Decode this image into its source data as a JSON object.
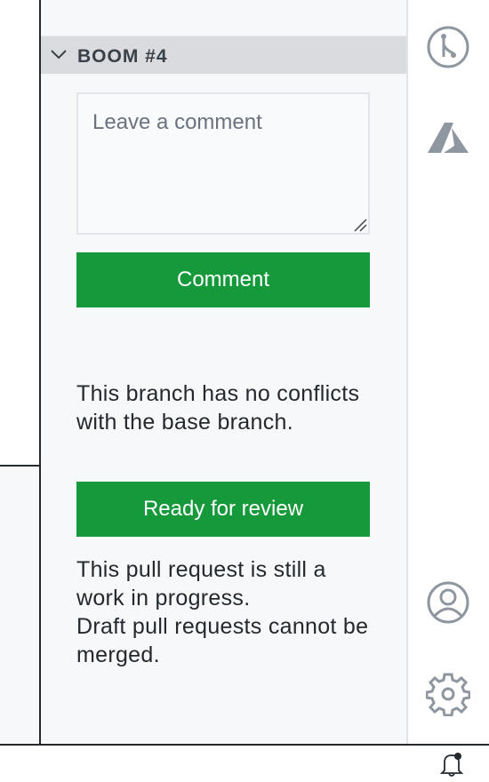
{
  "section": {
    "title": "BOOM #4"
  },
  "comment": {
    "placeholder": "Leave a comment",
    "value": "",
    "button_label": "Comment"
  },
  "merge_status": {
    "text": "This branch has no conflicts with the base branch."
  },
  "review": {
    "button_label": "Ready for review",
    "line1": "This pull request is still a work in progress.",
    "line2": "Draft pull requests cannot be merged."
  },
  "activity_bar": {
    "icons": [
      "pull-request-icon",
      "azure-icon",
      "account-icon",
      "settings-gear-icon"
    ]
  },
  "status_bar": {
    "icons": [
      "notification-bell-icon"
    ]
  },
  "colors": {
    "accent_green": "#16993a",
    "panel_bg": "#f6f8fa",
    "header_bg": "#d9dbde",
    "icon_gray": "#8e969f"
  }
}
